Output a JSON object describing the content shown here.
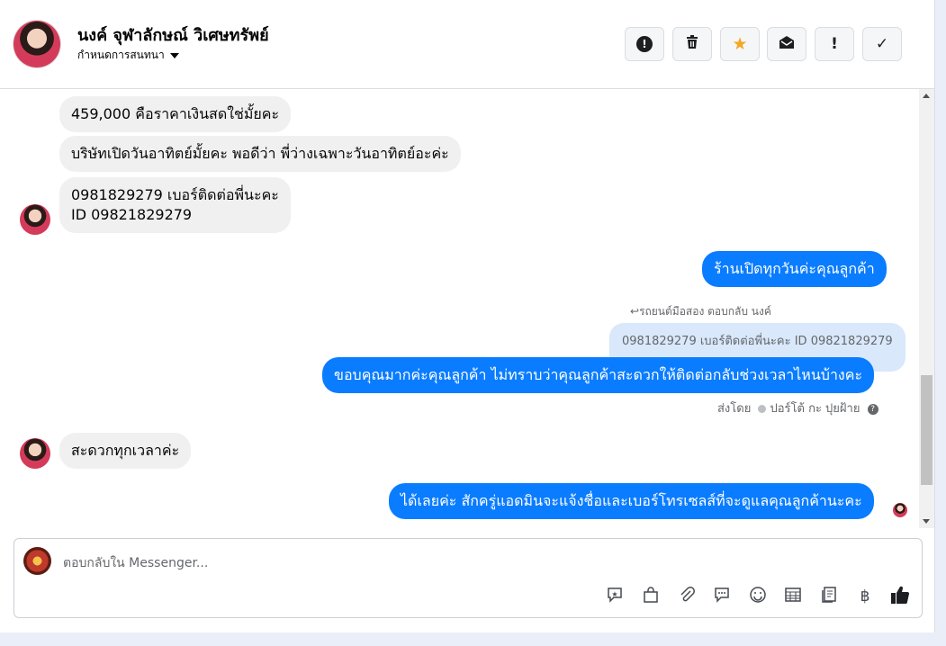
{
  "header": {
    "contact_name": "นงค์ จุฬาลักษณ์ วิเศษทรัพย์",
    "assign_label": "กำหนดการสนทนา",
    "actions": [
      {
        "icon": "alert-icon",
        "glyph": "!"
      },
      {
        "icon": "trash-icon",
        "glyph": "🗑"
      },
      {
        "icon": "star-icon",
        "glyph": "★"
      },
      {
        "icon": "mail-open-icon",
        "glyph": "✉"
      },
      {
        "icon": "follow-up-icon",
        "glyph": "!"
      },
      {
        "icon": "check-icon",
        "glyph": "✓"
      }
    ]
  },
  "messages": {
    "in_1": "459,000 คือราคาเงินสดใช่มั้ยคะ",
    "in_2": "บริษัทเปิดวันอาทิตย์มั้ยคะ พอดีว่า พี่ว่างเฉพาะวันอาทิตย์อะค่ะ",
    "in_3_line1": "0981829279 เบอร์ติดต่อพี่นะคะ",
    "in_3_line2": "ID 09821829279",
    "out_1": "ร้านเปิดทุกวันค่ะคุณลูกค้า",
    "reply_meta": "รถยนต์มือสอง ตอบกลับ นงค์",
    "quoted": "0981829279 เบอร์ติดต่อพี่นะคะ ID 09821829279",
    "out_2": "ขอบคุณมากค่ะคุณลูกค้า ไม่ทราบว่าคุณลูกค้าสะดวกให้ติดต่อกลับช่วงเวลาไหนบ้างคะ",
    "sent_by_prefix": "ส่งโดย",
    "sent_by_name": "ปอร์โต้ กะ ปุยฝ้าย",
    "in_4": "สะดวกทุกเวลาค่ะ",
    "out_3": "ได้เลยค่ะ สักครู่แอดมินจะแจ้งชื่อและเบอร์โทรเซลส์ที่จะดูแลคุณลูกค้านะคะ"
  },
  "composer": {
    "placeholder": "ตอบกลับใน Messenger...",
    "tools": [
      {
        "icon": "saved-reply-icon",
        "glyph": "✪"
      },
      {
        "icon": "shop-bag-icon",
        "glyph": "🛍"
      },
      {
        "icon": "attachment-icon",
        "glyph": "📎"
      },
      {
        "icon": "chat-icon",
        "glyph": "💬"
      },
      {
        "icon": "emoji-icon",
        "glyph": "☺"
      },
      {
        "icon": "table-icon",
        "glyph": "▦"
      },
      {
        "icon": "document-icon",
        "glyph": "🗐"
      },
      {
        "icon": "baht-icon",
        "glyph": "฿"
      },
      {
        "icon": "like-icon",
        "glyph": "👍"
      }
    ]
  }
}
